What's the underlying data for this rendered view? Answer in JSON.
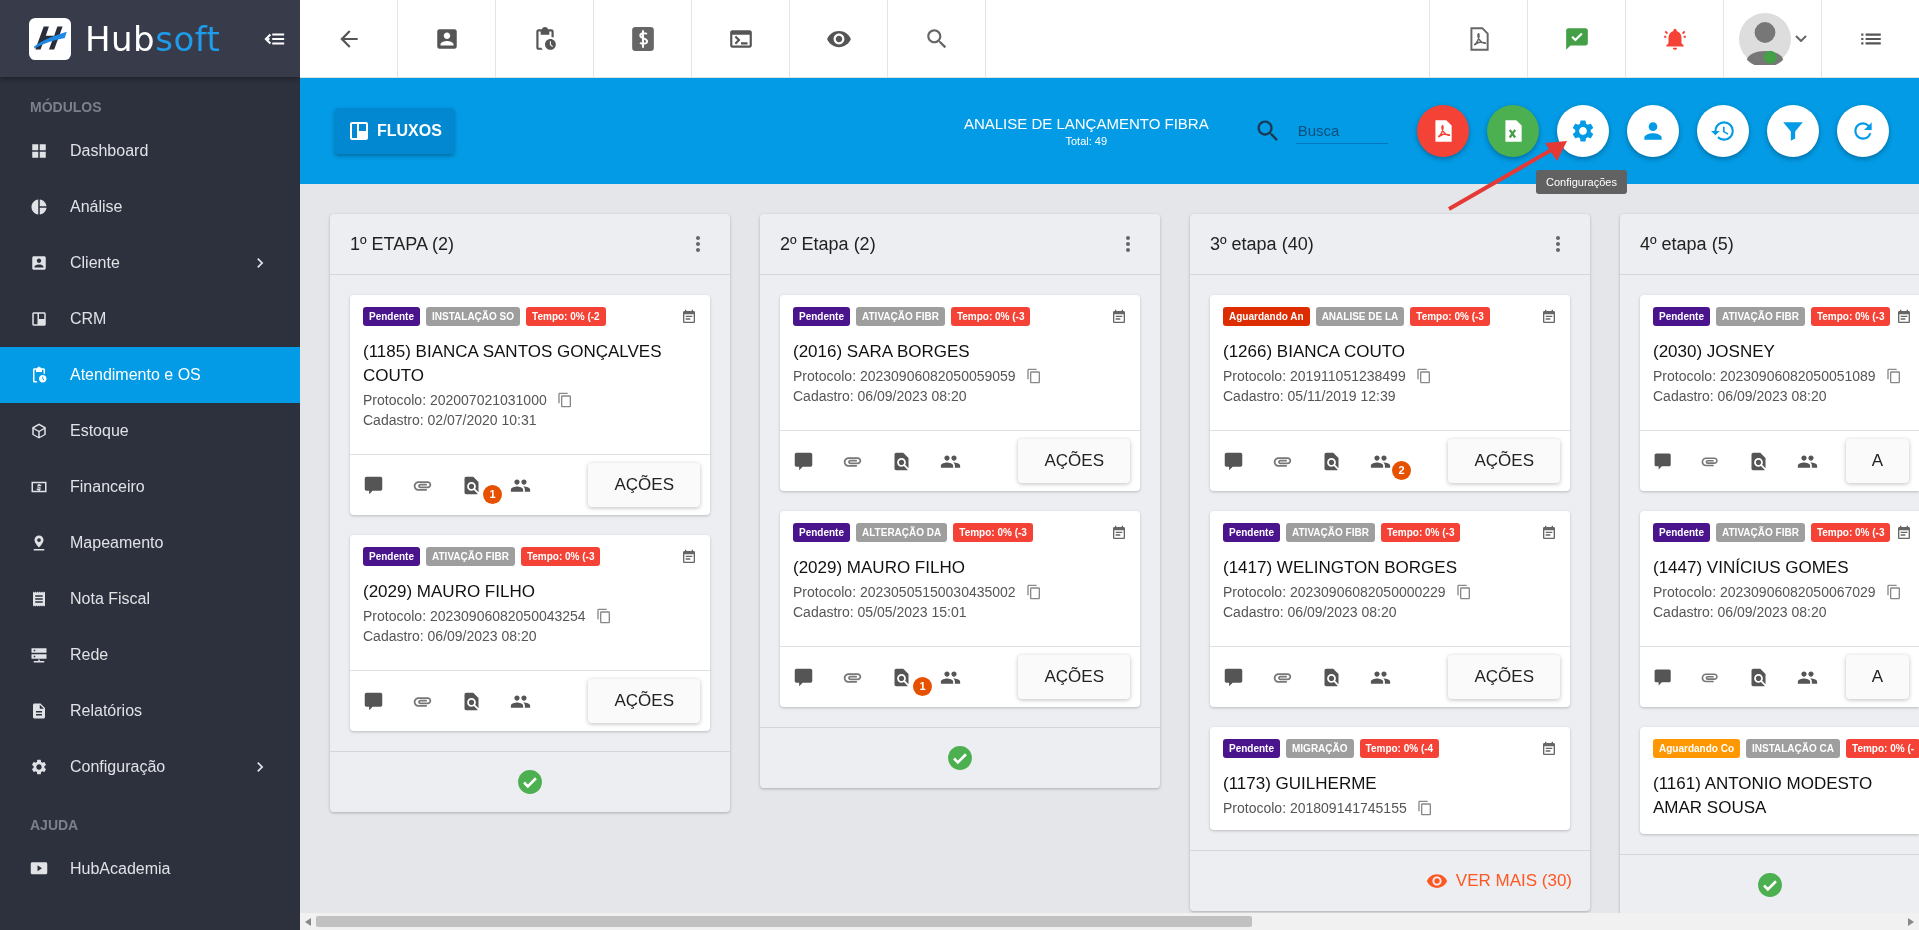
{
  "sidebar": {
    "brand": {
      "part_1": "Hub",
      "part_2": "soft"
    },
    "sections": [
      {
        "title": "MÓDULOS",
        "items": [
          {
            "label": "Dashboard",
            "selected": false,
            "expandable": false
          },
          {
            "label": "Análise",
            "selected": false,
            "expandable": false
          },
          {
            "label": "Cliente",
            "selected": false,
            "expandable": true
          },
          {
            "label": "CRM",
            "selected": false,
            "expandable": false
          },
          {
            "label": "Atendimento e OS",
            "selected": true,
            "expandable": false
          },
          {
            "label": "Estoque",
            "selected": false,
            "expandable": false
          },
          {
            "label": "Financeiro",
            "selected": false,
            "expandable": false
          },
          {
            "label": "Mapeamento",
            "selected": false,
            "expandable": false
          },
          {
            "label": "Nota Fiscal",
            "selected": false,
            "expandable": false
          },
          {
            "label": "Rede",
            "selected": false,
            "expandable": false
          },
          {
            "label": "Relatórios",
            "selected": false,
            "expandable": false
          },
          {
            "label": "Configuração",
            "selected": false,
            "expandable": true
          }
        ]
      },
      {
        "title": "AJUDA",
        "items": [
          {
            "label": "HubAcademia",
            "selected": false,
            "expandable": false
          }
        ]
      }
    ]
  },
  "header": {
    "board_button": "FLUXOS",
    "title": "ANALISE DE LANÇAMENTO FIBRA",
    "total": "Total: 49",
    "search": {
      "placeholder": "Busca"
    },
    "tooltip": "Configurações"
  },
  "columns": [
    {
      "title": "1º ETAPA (2)",
      "menu": true,
      "footer": {
        "kind": "check"
      },
      "cards": [
        {
          "tags": [
            {
              "text": "Pendente",
              "color": "#4a148c"
            },
            {
              "text": "INSTALAÇÃO SO",
              "color": "#9e9e9e"
            },
            {
              "text": "Tempo: 0% (-2",
              "color": "#f44336"
            }
          ],
          "name": "(1185) BIANCA SANTOS GONÇALVES COUTO",
          "protocol": "Protocolo: 202007021031000",
          "cadastro": "Cadastro: 02/07/2020 10:31",
          "actions": {
            "button": "AÇÕES",
            "doc_badge": "1"
          }
        },
        {
          "tags": [
            {
              "text": "Pendente",
              "color": "#4a148c"
            },
            {
              "text": "ATIVAÇÃO FIBR",
              "color": "#9e9e9e"
            },
            {
              "text": "Tempo: 0% (-3",
              "color": "#f44336"
            }
          ],
          "name": "(2029) MAURO FILHO",
          "protocol": "Protocolo: 20230906082050043254",
          "cadastro": "Cadastro: 06/09/2023 08:20",
          "actions": {
            "button": "AÇÕES"
          }
        }
      ]
    },
    {
      "title": "2º Etapa (2)",
      "menu": true,
      "footer": {
        "kind": "check"
      },
      "cards": [
        {
          "tags": [
            {
              "text": "Pendente",
              "color": "#4a148c"
            },
            {
              "text": "ATIVAÇÃO FIBR",
              "color": "#9e9e9e"
            },
            {
              "text": "Tempo: 0% (-3",
              "color": "#f44336"
            }
          ],
          "name": "(2016) SARA BORGES",
          "protocol": "Protocolo: 20230906082050059059",
          "cadastro": "Cadastro: 06/09/2023 08:20",
          "actions": {
            "button": "AÇÕES"
          }
        },
        {
          "tags": [
            {
              "text": "Pendente",
              "color": "#4a148c"
            },
            {
              "text": "ALTERAÇÃO DA",
              "color": "#9e9e9e"
            },
            {
              "text": "Tempo: 0% (-3",
              "color": "#f44336"
            }
          ],
          "name": "(2029) MAURO FILHO",
          "protocol": "Protocolo: 20230505150030435002",
          "cadastro": "Cadastro: 05/05/2023 15:01",
          "actions": {
            "button": "AÇÕES",
            "doc_badge": "1"
          }
        }
      ]
    },
    {
      "title": "3º etapa (40)",
      "menu": true,
      "footer": {
        "kind": "more",
        "label": "VER MAIS (30)"
      },
      "cards": [
        {
          "tags": [
            {
              "text": "Aguardando An",
              "color": "#dd2c00"
            },
            {
              "text": "ANALISE DE LA",
              "color": "#9e9e9e"
            },
            {
              "text": "Tempo: 0% (-3",
              "color": "#f44336"
            }
          ],
          "name": "(1266) BIANCA COUTO",
          "protocol": "Protocolo: 201911051238499",
          "cadastro": "Cadastro: 05/11/2019 12:39",
          "actions": {
            "button": "AÇÕES",
            "people_badge": "2"
          }
        },
        {
          "tags": [
            {
              "text": "Pendente",
              "color": "#4a148c"
            },
            {
              "text": "ATIVAÇÃO FIBR",
              "color": "#9e9e9e"
            },
            {
              "text": "Tempo: 0% (-3",
              "color": "#f44336"
            }
          ],
          "name": "(1417) WELINGTON BORGES",
          "protocol": "Protocolo: 20230906082050000229",
          "cadastro": "Cadastro: 06/09/2023 08:20",
          "actions": {
            "button": "AÇÕES"
          }
        },
        {
          "tags": [
            {
              "text": "Pendente",
              "color": "#4a148c"
            },
            {
              "text": "MIGRAÇÃO",
              "color": "#9e9e9e"
            },
            {
              "text": "Tempo: 0% (-4",
              "color": "#f44336"
            }
          ],
          "name": "(1173) GUILHERME",
          "protocol": "Protocolo: 201809141745155"
        }
      ]
    },
    {
      "title": "4º etapa (5)",
      "menu": false,
      "footer": {
        "kind": "check"
      },
      "cards": [
        {
          "tags": [
            {
              "text": "Pendente",
              "color": "#4a148c"
            },
            {
              "text": "ATIVAÇÃO FIBR",
              "color": "#9e9e9e"
            },
            {
              "text": "Tempo: 0% (-3",
              "color": "#f44336"
            }
          ],
          "name": "(2030) JOSNEY",
          "protocol": "Protocolo: 20230906082050051089",
          "cadastro": "Cadastro: 06/09/2023 08:20",
          "actions": {
            "button": "A"
          }
        },
        {
          "tags": [
            {
              "text": "Pendente",
              "color": "#4a148c"
            },
            {
              "text": "ATIVAÇÃO FIBR",
              "color": "#9e9e9e"
            },
            {
              "text": "Tempo: 0% (-3",
              "color": "#f44336"
            }
          ],
          "name": "(1447) VINÍCIUS GOMES",
          "protocol": "Protocolo: 20230906082050067029",
          "cadastro": "Cadastro: 06/09/2023 08:20",
          "actions": {
            "button": "A"
          }
        },
        {
          "tags": [
            {
              "text": "Aguardando Co",
              "color": "#ff9800"
            },
            {
              "text": "INSTALAÇÃO CA",
              "color": "#9e9e9e"
            },
            {
              "text": "Tempo: 0% (-",
              "color": "#f44336"
            }
          ],
          "name": "(1161) ANTONIO MODESTO AMAR SOUSA"
        }
      ]
    }
  ]
}
